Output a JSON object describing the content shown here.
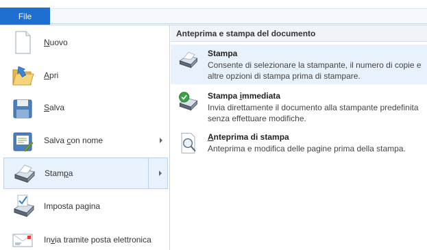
{
  "file_tab": "File",
  "left_menu": {
    "items": [
      {
        "pre": "",
        "key": "N",
        "post": "uovo",
        "icon": "new-document-icon",
        "arrow": false
      },
      {
        "pre": "",
        "key": "A",
        "post": "pri",
        "icon": "open-folder-icon",
        "arrow": false
      },
      {
        "pre": "",
        "key": "S",
        "post": "alva",
        "icon": "save-icon",
        "arrow": false
      },
      {
        "pre": "Salva ",
        "key": "c",
        "post": "on nome",
        "icon": "save-as-icon",
        "arrow": true
      },
      {
        "pre": "Stam",
        "key": "p",
        "post": "a",
        "icon": "print-icon",
        "arrow": true
      },
      {
        "pre": "Imposta pa",
        "key": "g",
        "post": "ina",
        "icon": "page-setup-icon",
        "arrow": false
      },
      {
        "pre": "In",
        "key": "v",
        "post": "ia tramite posta elettronica",
        "icon": "email-icon",
        "arrow": false
      }
    ]
  },
  "right_panel": {
    "header": "Anteprima e stampa del documento",
    "items": [
      {
        "title_pre": "Stampa",
        "title_key": "",
        "title_post": "",
        "desc": "Consente di selezionare la stampante, il numero di copie e altre opzioni di stampa prima di stampare.",
        "icon": "print-icon"
      },
      {
        "title_pre": "Stampa ",
        "title_key": "i",
        "title_post": "mmediata",
        "desc": "Invia direttamente il documento alla stampante predefinita senza effettuare modifiche.",
        "icon": "quick-print-icon"
      },
      {
        "title_pre": "",
        "title_key": "A",
        "title_post": "nteprima di stampa",
        "desc": "Anteprima e modifica delle pagine prima della stampa.",
        "icon": "print-preview-icon"
      }
    ]
  },
  "colors": {
    "file_tab": "#1f6fd0",
    "selected_bg": "#e8f2fc",
    "selected_border": "#b8d1ea"
  }
}
